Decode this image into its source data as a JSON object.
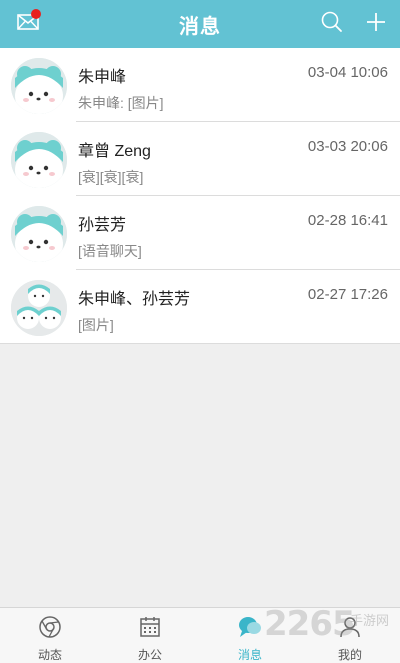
{
  "header": {
    "title": "消息",
    "icons": {
      "mail": "mail-icon",
      "search": "search-icon",
      "add": "plus-icon"
    },
    "accent_color": "#62c2d3",
    "has_unread_dot": true
  },
  "conversations": [
    {
      "name": "朱申峰",
      "time": "03-04 10:06",
      "preview": "朱申峰: [图片]",
      "avatar": "panda-avatar"
    },
    {
      "name": "章曾 Zeng",
      "time": "03-03 20:06",
      "preview": "[衰][衰][衰]",
      "avatar": "panda-avatar"
    },
    {
      "name": "孙芸芳",
      "time": "02-28 16:41",
      "preview": "[语音聊天]",
      "avatar": "panda-avatar"
    },
    {
      "name": "朱申峰、孙芸芳",
      "time": "02-27 17:26",
      "preview": "[图片]",
      "avatar": "group-panda-avatar"
    }
  ],
  "tabbar": {
    "tabs": [
      {
        "label": "动态",
        "icon": "chrome-circle-icon",
        "active": false
      },
      {
        "label": "办公",
        "icon": "calendar-icon",
        "active": false
      },
      {
        "label": "消息",
        "icon": "chat-bubble-icon",
        "active": true
      },
      {
        "label": "我的",
        "icon": "user-icon",
        "active": false
      }
    ],
    "active_color": "#3ab5c9"
  },
  "watermark": {
    "text": "2265",
    "sub": "手游网"
  }
}
